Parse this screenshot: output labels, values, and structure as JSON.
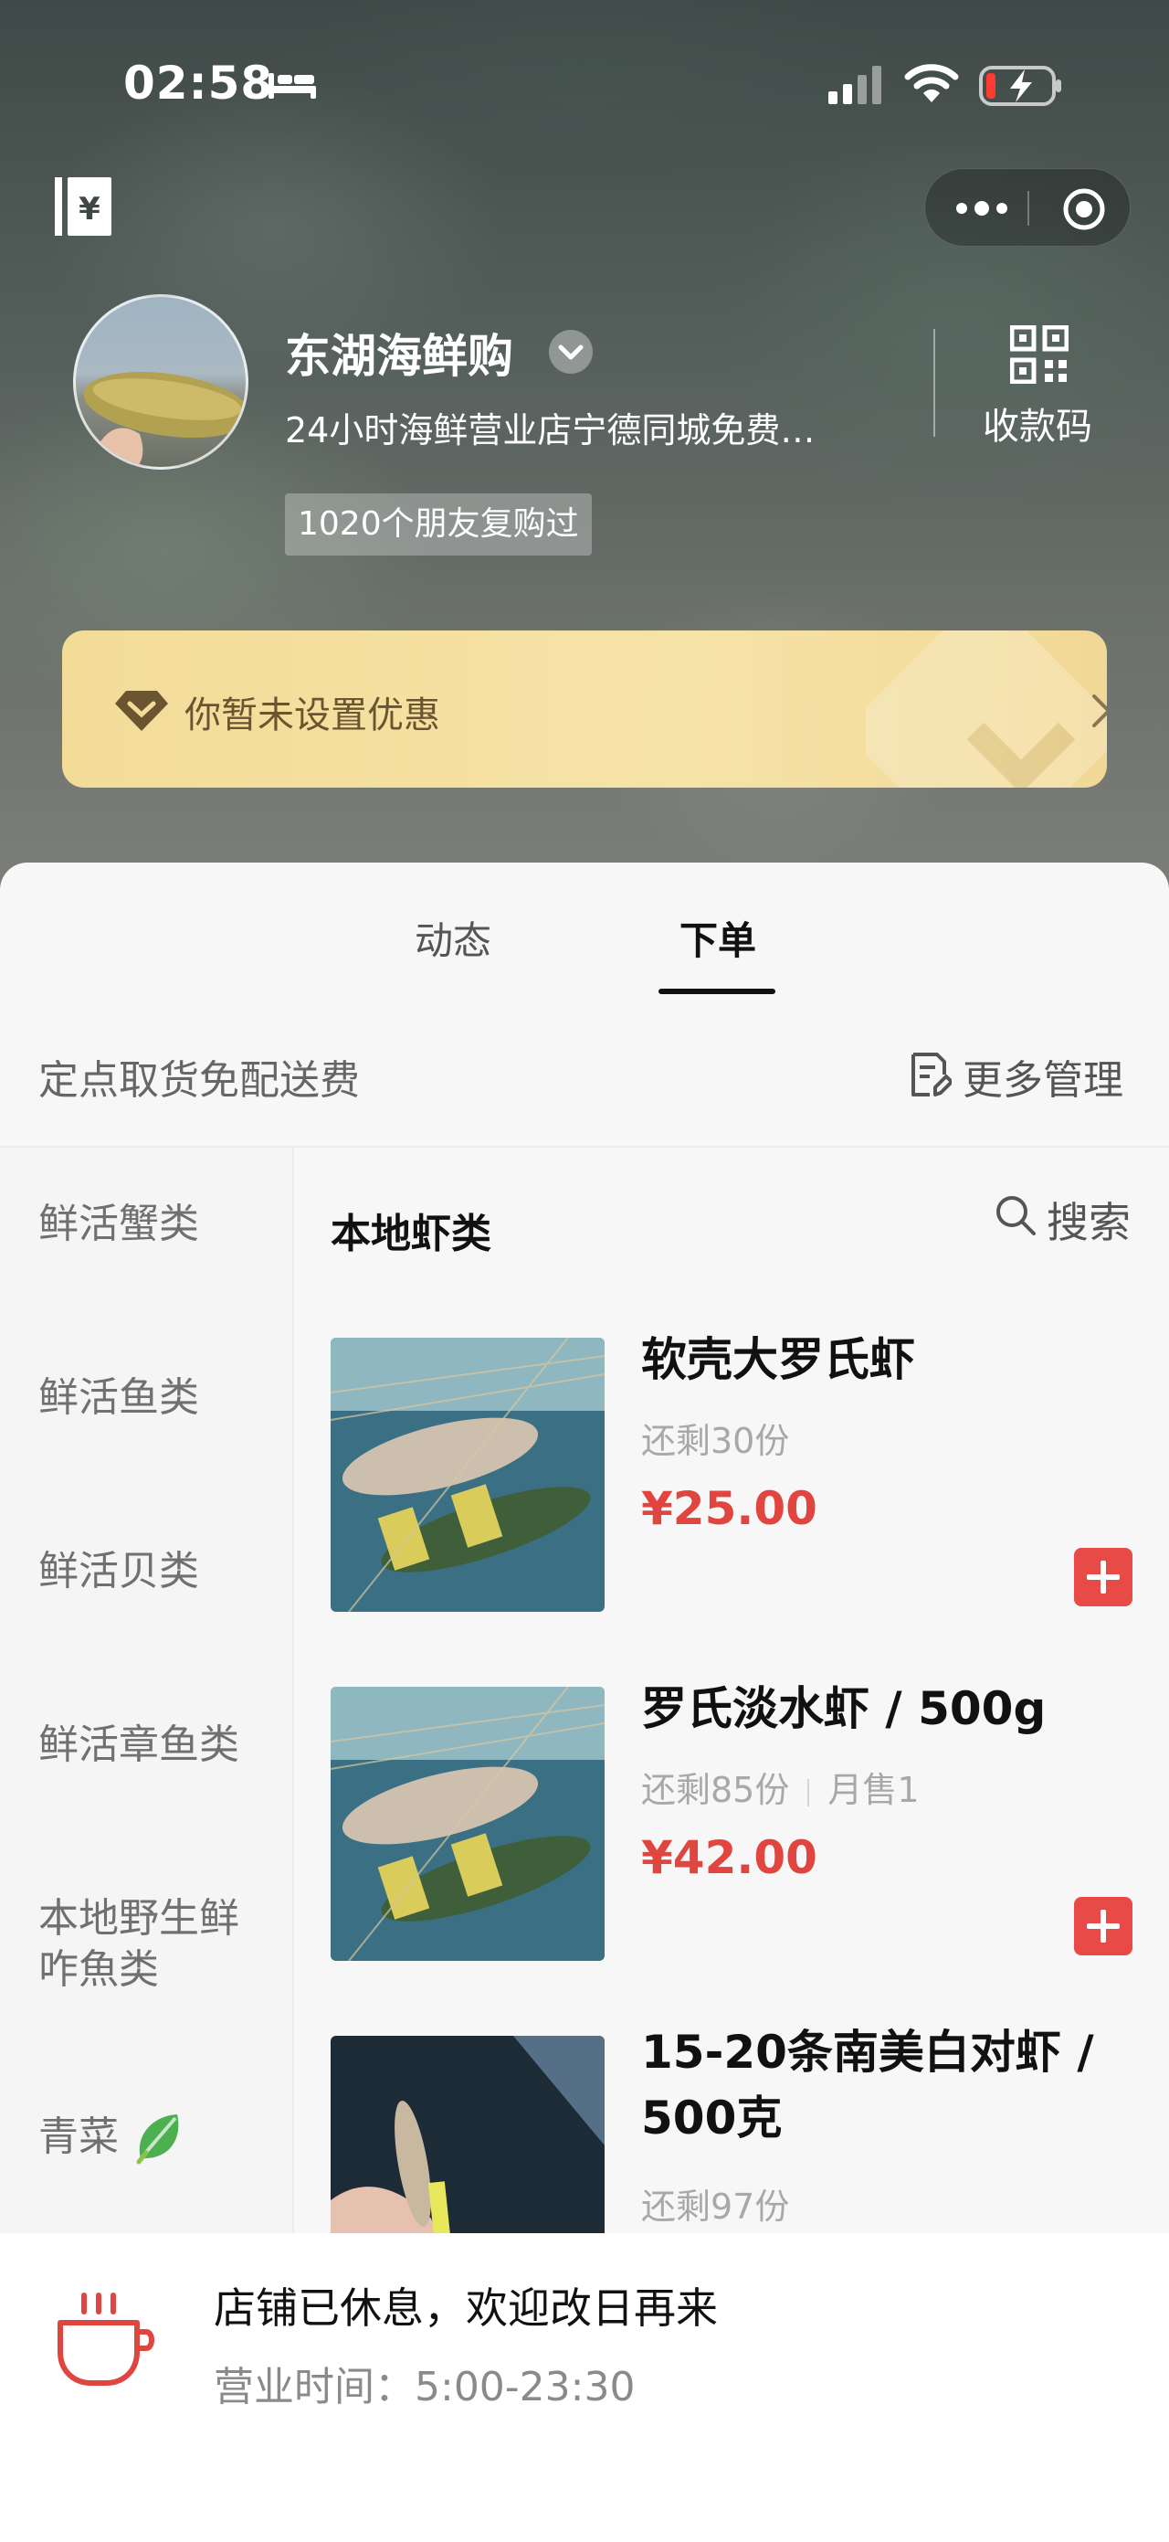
{
  "status_bar": {
    "time": "02:58"
  },
  "shop": {
    "name": "东湖海鲜购",
    "description": "24小时海鲜营业店宁德同城免费…",
    "repurchase_badge": "1020个朋友复购过",
    "qr_label": "收款码"
  },
  "coupon": {
    "text": "你暂未设置优惠"
  },
  "tabs": [
    {
      "label": "动态",
      "active": false
    },
    {
      "label": "下单",
      "active": true
    }
  ],
  "pickup": {
    "text": "定点取货免配送费",
    "manage_label": "更多管理"
  },
  "categories": [
    {
      "label": "鲜活蟹类"
    },
    {
      "label": "鲜活鱼类"
    },
    {
      "label": "鲜活贝类"
    },
    {
      "label": "鲜活章鱼类"
    },
    {
      "label": "本地野生鲜咋魚类"
    },
    {
      "label": "青菜"
    }
  ],
  "section": {
    "title": "本地虾类",
    "search_label": "搜索"
  },
  "products": [
    {
      "name": "软壳大罗氏虾",
      "stock": "还剩30份",
      "monthly_sales": "",
      "price": "¥25.00"
    },
    {
      "name": "罗氏淡水虾 / 500g",
      "stock": "还剩85份",
      "monthly_sales": "月售1",
      "price": "¥42.00"
    },
    {
      "name": "15-20条南美白对虾 / 500克",
      "stock": "还剩97份",
      "monthly_sales": "",
      "price": ""
    }
  ],
  "closed": {
    "title": "店铺已休息，欢迎改日再来",
    "hours": "营业时间：5:00-23:30"
  },
  "colors": {
    "price": "#e0453f",
    "add_button": "#e84a48",
    "coupon_bg": "#f3dc98"
  },
  "icons": [
    "bed-icon",
    "signal-icon",
    "wifi-icon",
    "battery-icon",
    "wallet-icon",
    "more-icon",
    "record-icon",
    "verify-chevron-icon",
    "qr-code-icon",
    "coupon-icon",
    "chevron-right-icon",
    "manage-icon",
    "search-icon",
    "lettuce-icon",
    "plus-icon",
    "cup-icon"
  ]
}
